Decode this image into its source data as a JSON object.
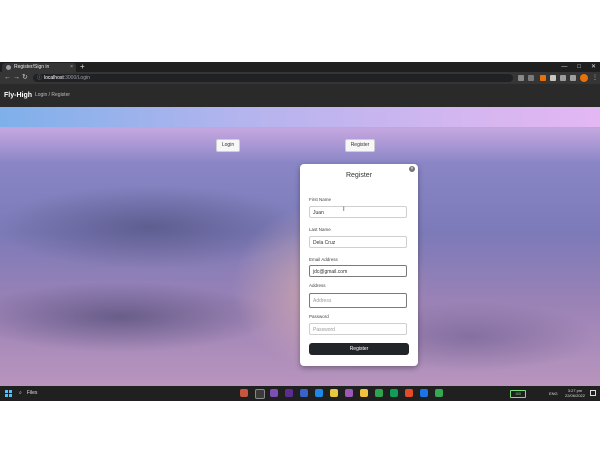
{
  "browser": {
    "tab_title": "Register/Sign in",
    "tab_close": "×",
    "new_tab": "+",
    "url_host": "localhost",
    "url_path": ":3000/Login",
    "window_controls": [
      "—",
      "□",
      "✕"
    ]
  },
  "app": {
    "brand": "Fly-High",
    "nav_link": "Login / Register"
  },
  "page": {
    "login_button": "Login",
    "register_button": "Register"
  },
  "modal": {
    "title": "Register",
    "close_glyph": "×",
    "fields": {
      "first_name": {
        "label": "First Name",
        "value": "Juan"
      },
      "last_name": {
        "label": "Last Name",
        "value": "Dela Cruz"
      },
      "email": {
        "label": "Email Address",
        "value": "jdc@gmail.com"
      },
      "address": {
        "label": "Address",
        "placeholder": "Address"
      },
      "password": {
        "label": "Password",
        "placeholder": "Password"
      }
    },
    "submit": "Register"
  },
  "taskbar": {
    "search_label": "Files",
    "battery": "100",
    "language": "ENG",
    "time": "3:27 pm",
    "date": "22/06/2022"
  },
  "colors": {
    "modal_submit": "#212529",
    "app_nav": "#2a2a2a",
    "taskbar": "#202020"
  }
}
